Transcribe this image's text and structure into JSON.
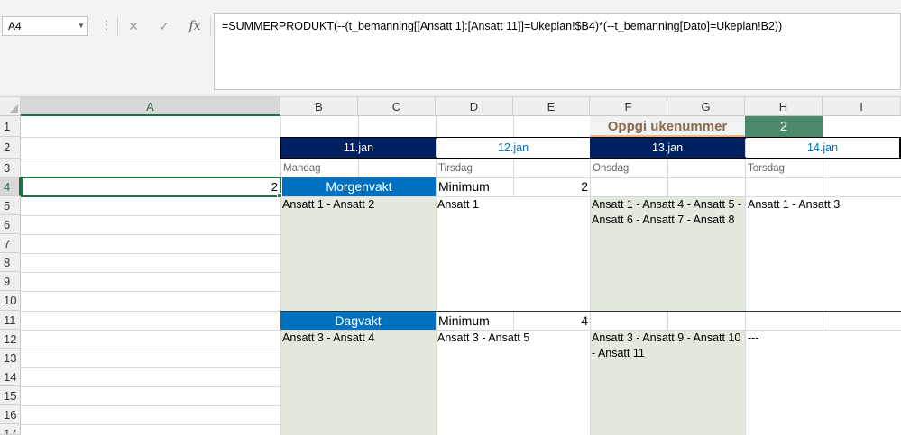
{
  "formula": {
    "name_box": "A4",
    "cancel_glyph": "✕",
    "confirm_glyph": "✓",
    "fx_glyph": "fx",
    "text": "=SUMMERPRODUKT(--(t_bemanning[[Ansatt 1]:[Ansatt 11]]=Ukeplan!$B4)*(--t_bemanning[Dato]=Ukeplan!B2))"
  },
  "columns": [
    "A",
    "B",
    "C",
    "D",
    "E",
    "F",
    "G",
    "H",
    "I"
  ],
  "rows": [
    "1",
    "2",
    "3",
    "4",
    "5",
    "6",
    "7",
    "8",
    "9",
    "10",
    "11",
    "12",
    "13",
    "14",
    "15",
    "16",
    "17"
  ],
  "cells": {
    "week_label": "Oppgi ukenummer",
    "week_value": "2",
    "dates": [
      "11.jan",
      "12.jan",
      "13.jan",
      "14.jan"
    ],
    "days": [
      "Mandag",
      "Tirsdag",
      "Onsdag",
      "Torsdag"
    ],
    "a4_value": "2",
    "morning": {
      "label": "Morgenvakt",
      "min_label": "Minimum",
      "min_value": "2",
      "entries": [
        "Ansatt 1 - Ansatt 2",
        "Ansatt 1",
        "Ansatt 1 - Ansatt 4 - Ansatt 5 - Ansatt 6 - Ansatt 7 - Ansatt 8",
        "Ansatt 1 - Ansatt 3"
      ]
    },
    "day": {
      "label": "Dagvakt",
      "min_label": "Minimum",
      "min_value": "4",
      "entries": [
        "Ansatt 3 - Ansatt 4",
        "Ansatt 3 - Ansatt 5",
        "Ansatt 3 - Ansatt 9 - Ansatt 10 - Ansatt 11",
        "---"
      ]
    }
  },
  "colors": {
    "dark_navy": "#002060",
    "blue": "#0070c0",
    "green_cell": "#4a8a6a",
    "shade": "#e3e9dc",
    "orange_line": "#f4b183"
  }
}
